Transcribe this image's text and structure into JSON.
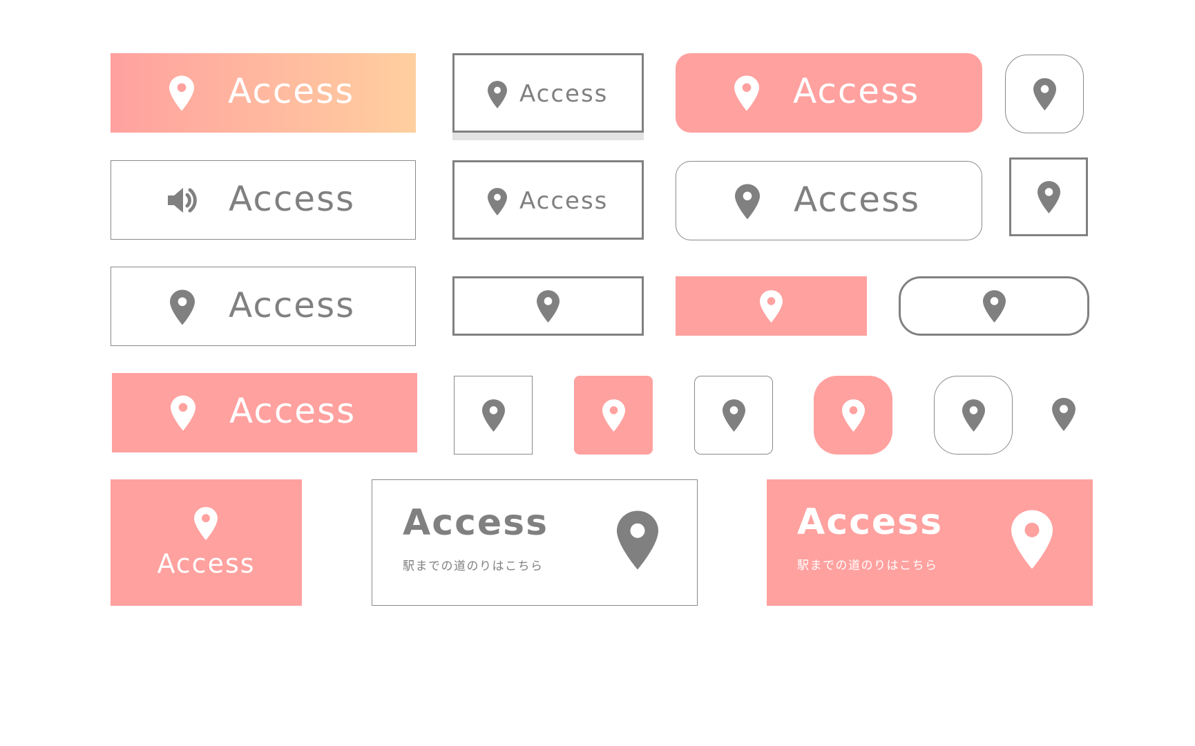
{
  "colors": {
    "accent": "#FFA19F",
    "accent_gradient_end": "#FFCF9F",
    "icon_grey": "#808080",
    "white": "#FFFFFF"
  },
  "icons": {
    "pin": "map-pin-icon",
    "speaker": "speaker-icon"
  },
  "buttons": {
    "access_label": "Access",
    "card_title": "Access",
    "card_subtitle": "駅までの道のりはこちら"
  }
}
